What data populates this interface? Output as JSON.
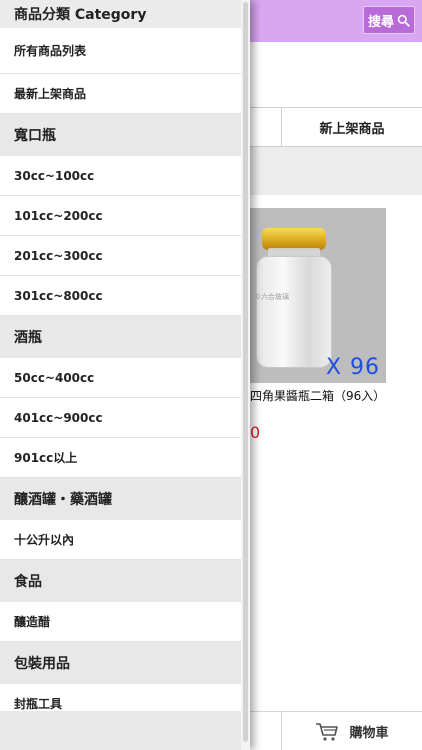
{
  "colors": {
    "accent": "#d9a7f2",
    "search_button": "#b86ad6",
    "price": "#e0181e",
    "badge": "#1f4fe0"
  },
  "header": {
    "search_label": "搜尋",
    "search_icon": "magnifier"
  },
  "tabs": {
    "new_products": "新上架商品"
  },
  "product": {
    "name": "四角果醬瓶二箱（96入）",
    "badge": "X 96",
    "price_fragment": "0",
    "watermark": "©六合玻璃"
  },
  "bottom": {
    "cart_label": "購物車",
    "cart_icon": "shopping-cart"
  },
  "drawer": {
    "title": "商品分類 Category",
    "top_items": [
      "所有商品列表",
      "最新上架商品"
    ],
    "groups": [
      {
        "title": "寬口瓶",
        "items": [
          "30cc~100cc",
          "101cc~200cc",
          "201cc~300cc",
          "301cc~800cc"
        ]
      },
      {
        "title": "酒瓶",
        "items": [
          "50cc~400cc",
          "401cc~900cc",
          "901cc以上"
        ]
      },
      {
        "title": "釀酒罐・藥酒罐",
        "items": [
          "十公升以內"
        ]
      },
      {
        "title": "食品",
        "items": [
          "釀造醋"
        ]
      },
      {
        "title": "包裝用品",
        "items": [
          "封瓶工具"
        ]
      }
    ]
  }
}
